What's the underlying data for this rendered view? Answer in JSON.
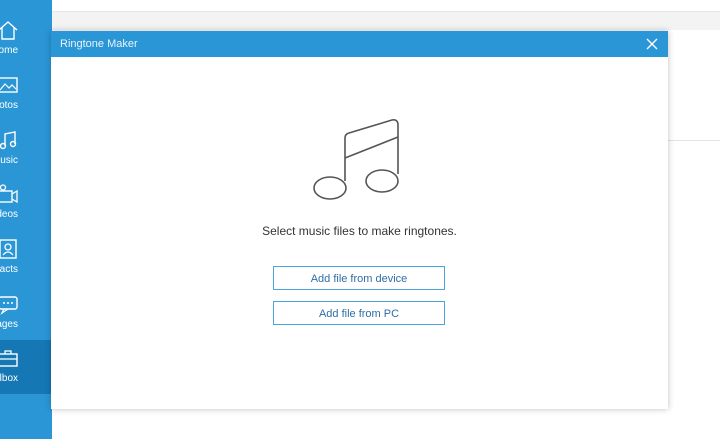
{
  "sidebar": {
    "items": [
      {
        "label": "ome",
        "icon": "home-icon"
      },
      {
        "label": "hotos",
        "icon": "photos-icon"
      },
      {
        "label": "lusic",
        "icon": "music-icon"
      },
      {
        "label": "ideos",
        "icon": "videos-icon"
      },
      {
        "label": "ntacts",
        "icon": "contacts-icon"
      },
      {
        "label": "ssages",
        "icon": "messages-icon"
      },
      {
        "label": "olbox",
        "icon": "toolbox-icon"
      }
    ],
    "active_index": 6
  },
  "dialog": {
    "title": "Ringtone Maker",
    "message": "Select music files to make ringtones.",
    "btn_device": "Add file from device",
    "btn_pc": "Add file from PC"
  },
  "colors": {
    "accent": "#2a96d6",
    "active": "#1677b5",
    "button_border": "#4aa6dc",
    "button_text": "#2f6ea5"
  }
}
